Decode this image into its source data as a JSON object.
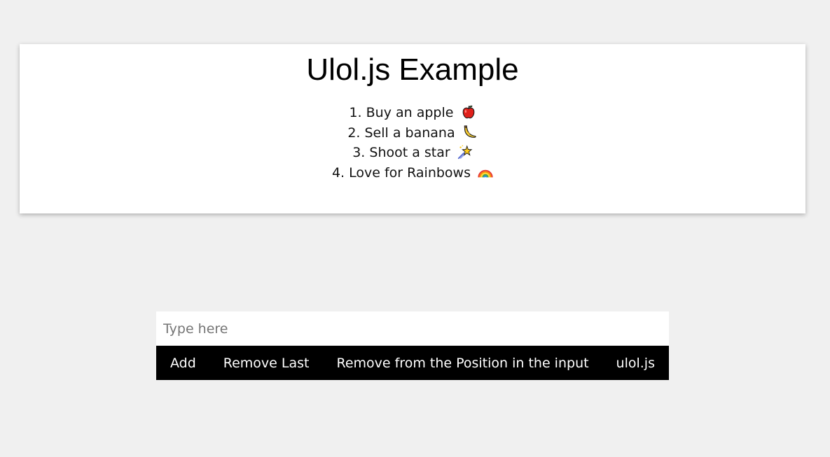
{
  "header": {
    "title": "Ulol.js Example"
  },
  "list": {
    "items": [
      {
        "label": "1. Buy an apple",
        "icon": "apple-icon"
      },
      {
        "label": "2. Sell a banana",
        "icon": "banana-icon"
      },
      {
        "label": "3. Shoot a star",
        "icon": "shooting-star-icon"
      },
      {
        "label": "4. Love for Rainbows",
        "icon": "rainbow-icon"
      }
    ]
  },
  "input": {
    "placeholder": "Type here",
    "value": ""
  },
  "toolbar": {
    "add_label": "Add",
    "remove_last_label": "Remove Last",
    "remove_position_label": "Remove from the Position in the input",
    "ulol_label": "ulol.js"
  },
  "colors": {
    "page_background": "#f0f0f0",
    "card_background": "#ffffff",
    "button_bar_background": "#000000",
    "button_text": "#ffffff"
  }
}
